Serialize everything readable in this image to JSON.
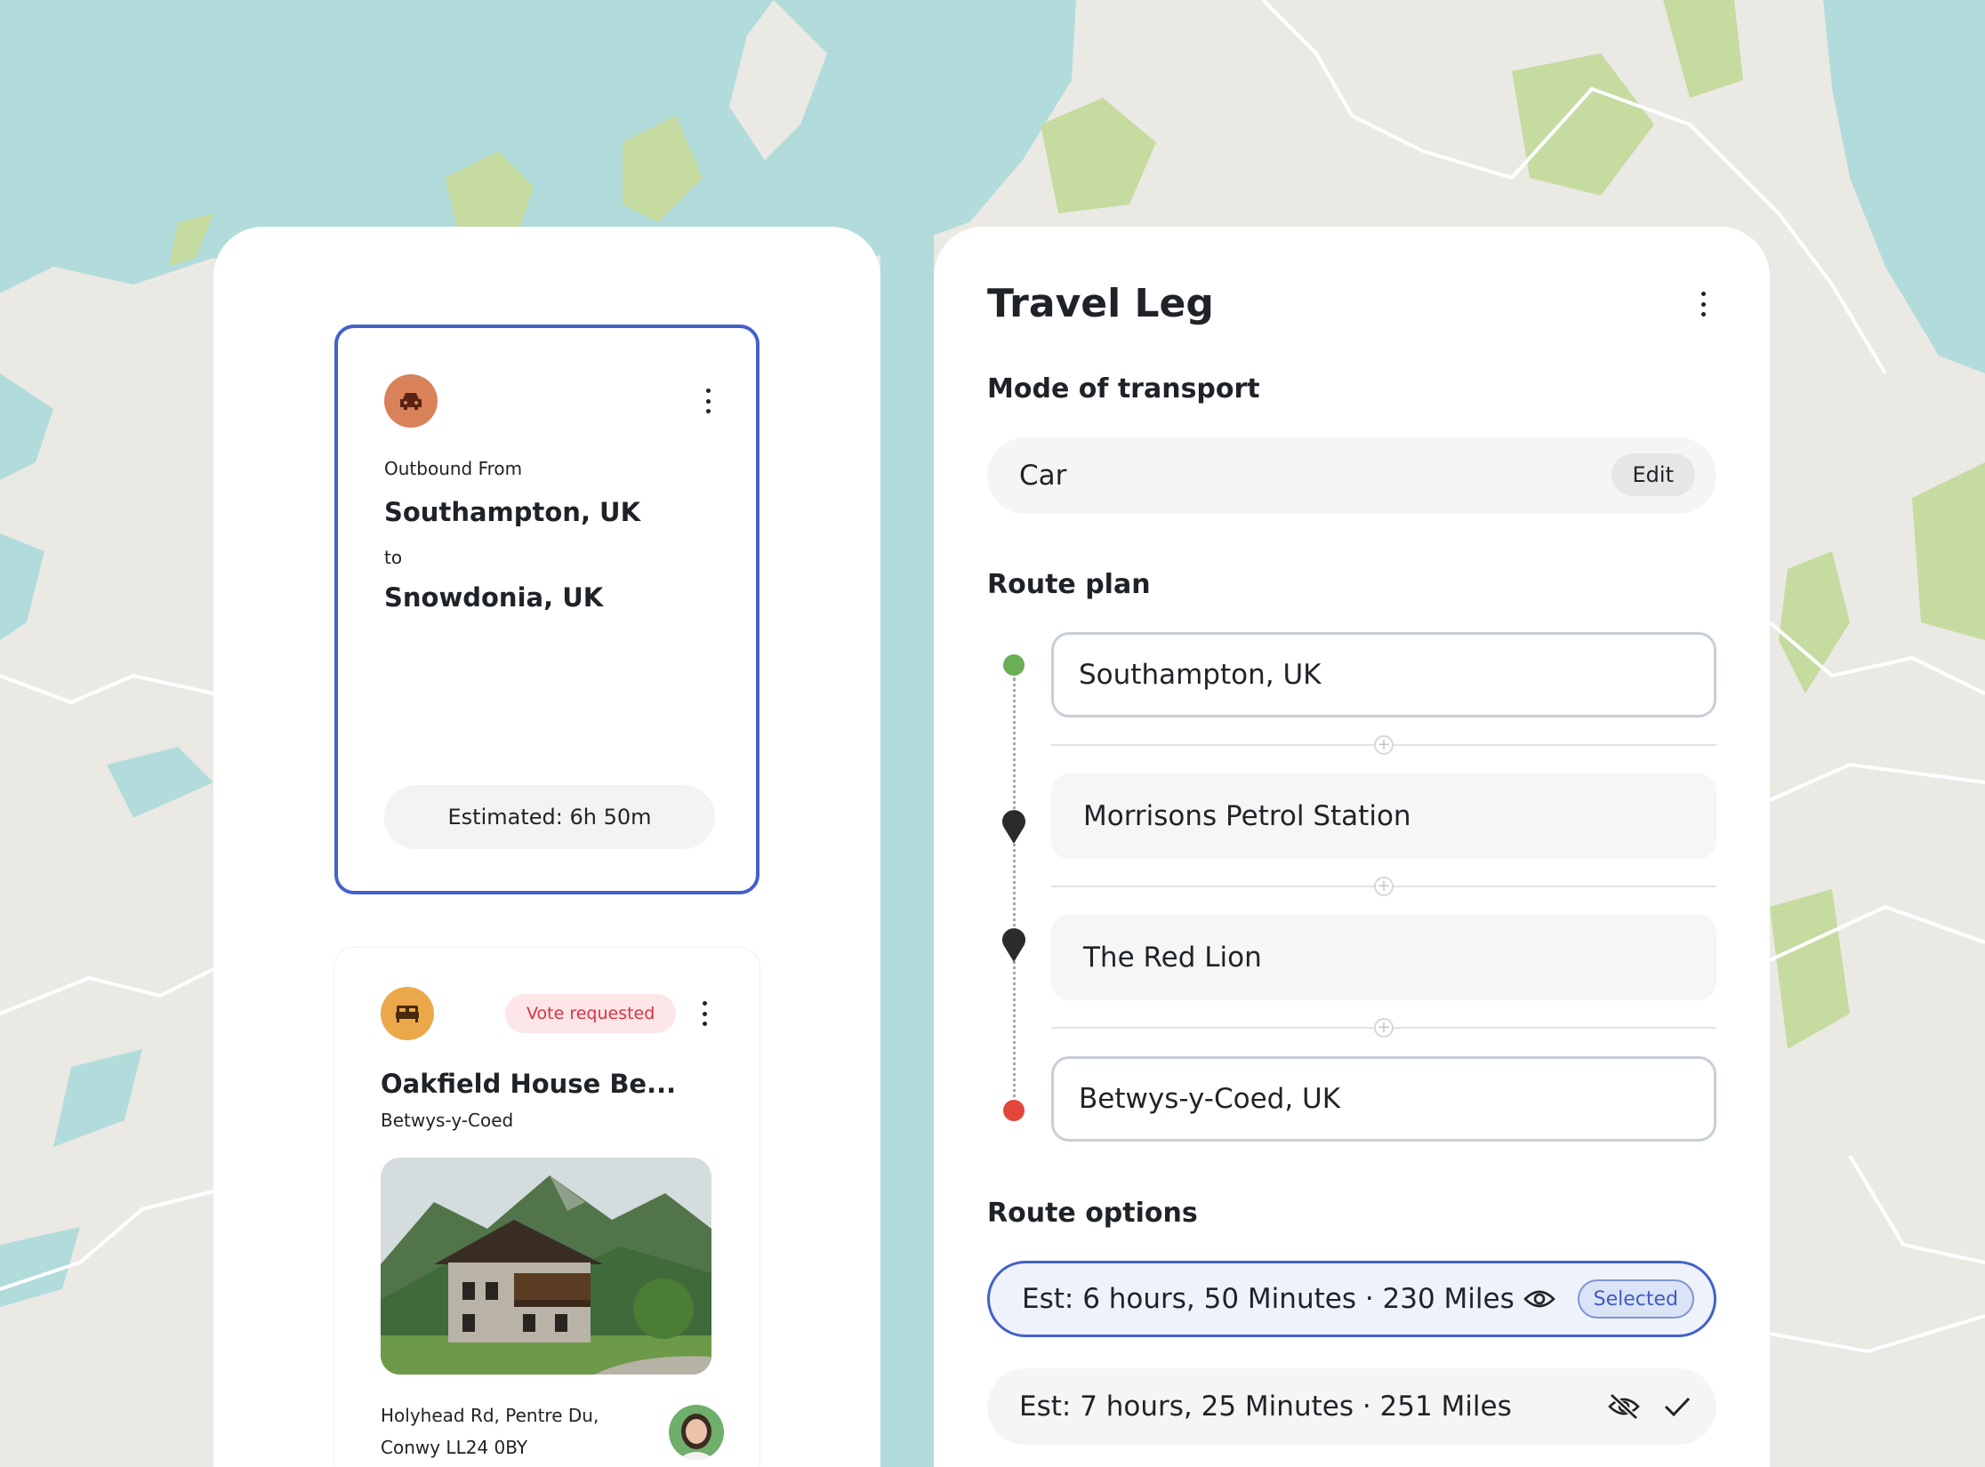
{
  "colors": {
    "water": "#b2dcdb",
    "land": "#ebe9e4",
    "forest": "#c5dba0",
    "accent": "#4361c9",
    "start_dot": "#6aae56",
    "end_dot": "#e4453b",
    "car_icon_bg": "#d9825a",
    "bed_icon_bg": "#eba84a"
  },
  "trip_card": {
    "icon": "car-icon",
    "from_label": "Outbound From",
    "from_place": "Southampton, UK",
    "to_label": "to",
    "to_place": "Snowdonia, UK",
    "estimate": "Estimated: 6h 50m"
  },
  "stay_card": {
    "icon": "bed-icon",
    "badge": "Vote requested",
    "title": "Oakfield House Be...",
    "subtitle": "Betwys-y-Coed",
    "address_line1": "Holyhead Rd, Pentre Du,",
    "address_line2": "Conwy LL24 0BY"
  },
  "travel_leg": {
    "title": "Travel Leg",
    "mode_heading": "Mode of transport",
    "mode_value": "Car",
    "edit_label": "Edit",
    "route_heading": "Route plan",
    "stops": [
      "Southampton, UK",
      "Morrisons Petrol Station",
      "The Red Lion",
      "Betwys-y-Coed, UK"
    ],
    "options_heading": "Route options",
    "options": [
      {
        "text": "Est: 6 hours, 50 Minutes · 230 Miles",
        "badge": "Selected",
        "icon": "eye-icon"
      },
      {
        "text": "Est: 7 hours, 25 Minutes · 251 Miles",
        "icon": "eye-off-icon",
        "action_icon": "check-icon"
      }
    ]
  }
}
